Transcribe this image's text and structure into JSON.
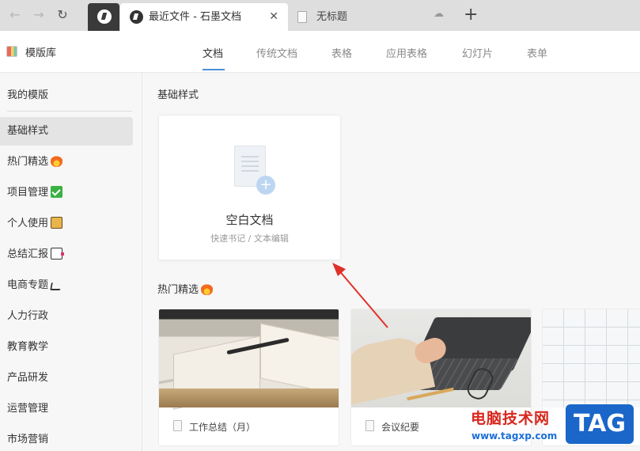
{
  "browser": {
    "tabs": [
      {
        "label": "最近文件 - 石墨文档",
        "active": true
      },
      {
        "label": "无标题",
        "active": false
      }
    ],
    "close_glyph": "✕",
    "new_tab_glyph": "+",
    "back_glyph": "←",
    "forward_glyph": "→",
    "reload_glyph": "↻",
    "cloud_glyph": "☁"
  },
  "header": {
    "title": "模版库",
    "type_tabs": [
      "文档",
      "传统文档",
      "表格",
      "应用表格",
      "幻灯片",
      "表单"
    ],
    "active_tab": "文档"
  },
  "sidebar": {
    "items": [
      {
        "label": "我的模版"
      },
      {
        "label": "基础样式",
        "selected": true
      },
      {
        "label": "热门精选",
        "icon": "fire-icon"
      },
      {
        "label": "项目管理",
        "icon": "check-box-icon"
      },
      {
        "label": "个人使用",
        "icon": "person-icon"
      },
      {
        "label": "总结汇报",
        "icon": "report-icon"
      },
      {
        "label": "电商专题",
        "icon": "cart-icon"
      },
      {
        "label": "人力行政"
      },
      {
        "label": "教育教学"
      },
      {
        "label": "产品研发"
      },
      {
        "label": "运营管理"
      },
      {
        "label": "市场营销"
      }
    ]
  },
  "main": {
    "section_basic": "基础样式",
    "blank_card": {
      "title": "空白文档",
      "subtitle": "快速书记 / 文本编辑"
    },
    "section_hot": "热门精选",
    "templates": [
      {
        "label": "工作总结（月）"
      },
      {
        "label": "会议纪要"
      },
      {
        "label": ""
      }
    ]
  },
  "watermark": {
    "text": "电脑技术网",
    "url": "www.tagxp.com",
    "badge": "TAG"
  },
  "colors": {
    "accent": "#4a90d9",
    "arrow": "#e0312a"
  }
}
